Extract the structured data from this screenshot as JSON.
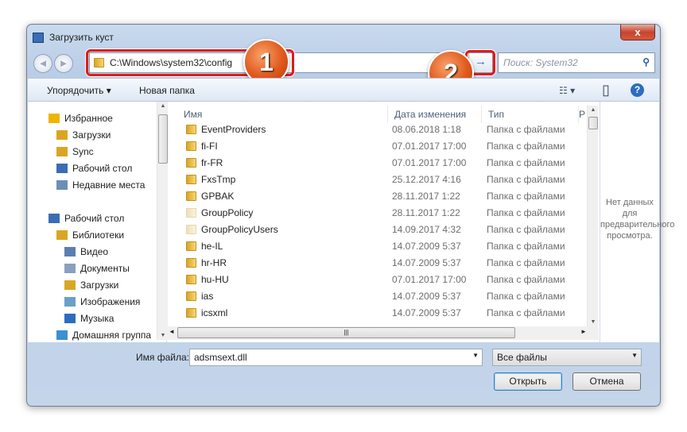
{
  "window": {
    "title": "Загрузить куст",
    "close": "x"
  },
  "nav": {
    "back": "◄",
    "forward": "►"
  },
  "address": {
    "path": "C:\\Windows\\system32\\config",
    "go": "→"
  },
  "search": {
    "placeholder": "Поиск: System32",
    "icon": "search-icon"
  },
  "callouts": [
    "1",
    "2"
  ],
  "toolbar": {
    "organize": "Упорядочить ▾",
    "new_folder": "Новая папка",
    "views": "☷ ▾",
    "preview_pane": "▯",
    "help": "?"
  },
  "sidebar": {
    "items": [
      {
        "label": "Избранное",
        "icon": "star-icon"
      },
      {
        "label": "Загрузки",
        "icon": "downloads-icon"
      },
      {
        "label": "Sync",
        "icon": "folder-icon"
      },
      {
        "label": "Рабочий стол",
        "icon": "desktop-icon"
      },
      {
        "label": "Недавние места",
        "icon": "recent-icon"
      },
      {
        "label": "Рабочий стол",
        "icon": "desktop-icon"
      },
      {
        "label": "Библиотеки",
        "icon": "libraries-icon"
      },
      {
        "label": "Видео",
        "icon": "video-icon"
      },
      {
        "label": "Документы",
        "icon": "documents-icon"
      },
      {
        "label": "Загрузки",
        "icon": "downloads-icon"
      },
      {
        "label": "Изображения",
        "icon": "pictures-icon"
      },
      {
        "label": "Музыка",
        "icon": "music-icon"
      },
      {
        "label": "Домашняя группа",
        "icon": "homegroup-icon"
      }
    ]
  },
  "columns": {
    "name": "Имя",
    "date": "Дата изменения",
    "type": "Тип",
    "size": "Р"
  },
  "files": [
    {
      "name": "EventProviders",
      "date": "08.06.2018 1:18",
      "type": "Папка с файлами"
    },
    {
      "name": "fi-FI",
      "date": "07.01.2017 17:00",
      "type": "Папка с файлами"
    },
    {
      "name": "fr-FR",
      "date": "07.01.2017 17:00",
      "type": "Папка с файлами"
    },
    {
      "name": "FxsTmp",
      "date": "25.12.2017 4:16",
      "type": "Папка с файлами"
    },
    {
      "name": "GPBAK",
      "date": "28.11.2017 1:22",
      "type": "Папка с файлами"
    },
    {
      "name": "GroupPolicy",
      "date": "28.11.2017 1:22",
      "type": "Папка с файлами"
    },
    {
      "name": "GroupPolicyUsers",
      "date": "14.09.2017 4:32",
      "type": "Папка с файлами"
    },
    {
      "name": "he-IL",
      "date": "14.07.2009 5:37",
      "type": "Папка с файлами"
    },
    {
      "name": "hr-HR",
      "date": "14.07.2009 5:37",
      "type": "Папка с файлами"
    },
    {
      "name": "hu-HU",
      "date": "07.01.2017 17:00",
      "type": "Папка с файлами"
    },
    {
      "name": "ias",
      "date": "14.07.2009 5:37",
      "type": "Папка с файлами"
    },
    {
      "name": "icsxml",
      "date": "14.07.2009 5:37",
      "type": "Папка с файлами"
    }
  ],
  "preview": {
    "text": "Нет данных для предварительного просмотра."
  },
  "footer": {
    "filename_label": "Имя файла:",
    "filename": "adsmsext.dll",
    "filter": "Все файлы",
    "open": "Открыть",
    "cancel": "Отмена"
  }
}
